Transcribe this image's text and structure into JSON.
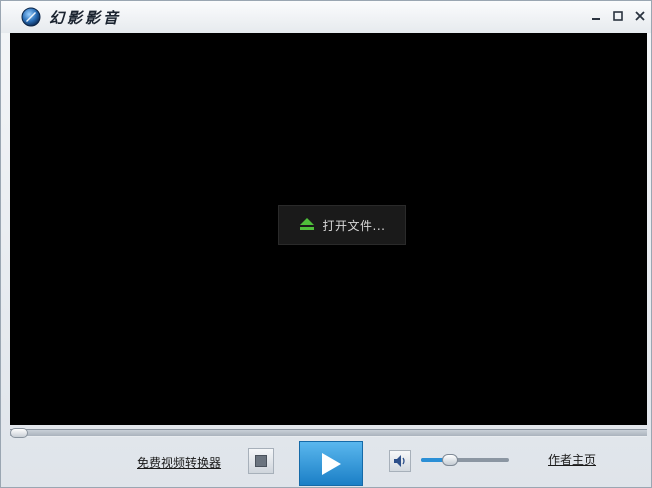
{
  "window": {
    "title": "幻影影音",
    "controls": {
      "minimize_icon": "minimize-icon",
      "maximize_icon": "maximize-icon",
      "close_icon": "close-icon"
    }
  },
  "video": {
    "open_file_label": "打开文件...",
    "open_file_icon": "eject-icon",
    "eject_color": "#4fbf3a"
  },
  "playback": {
    "seek_position": 0,
    "volume": 0.33,
    "play_icon": "play-icon",
    "stop_icon": "stop-icon",
    "volume_icon": "speaker-icon",
    "accent_color": "#2a8fd6"
  },
  "links": {
    "converter": "免费视频转换器",
    "author_home": "作者主页"
  }
}
